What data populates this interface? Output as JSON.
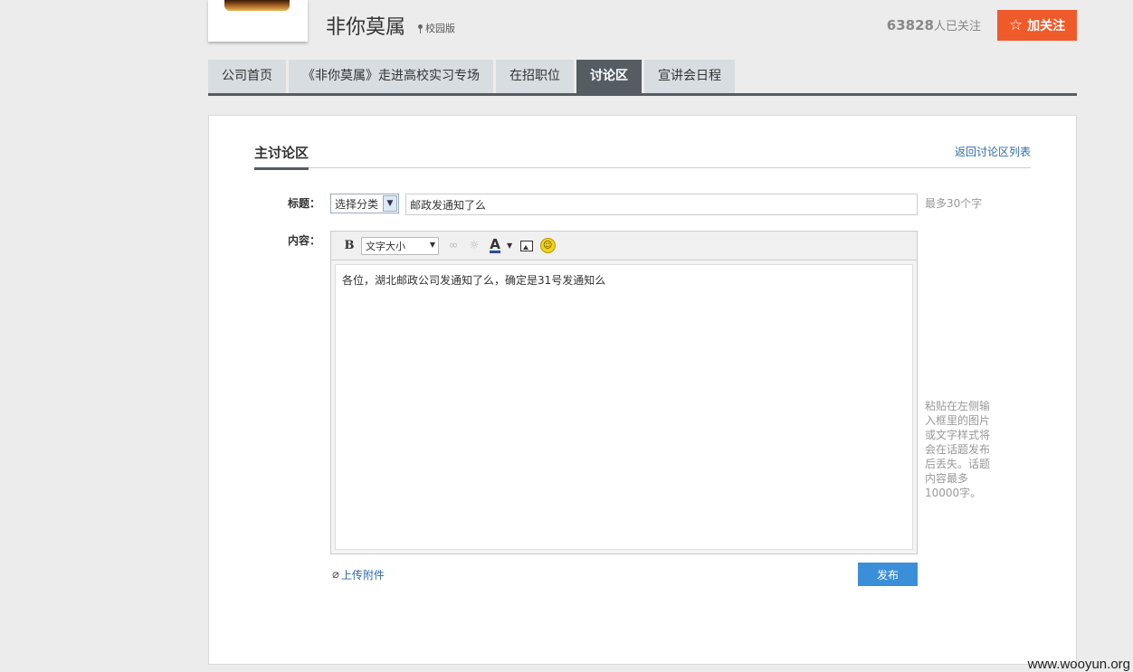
{
  "header": {
    "company_name": "非你莫属",
    "campus_tag": "校园版",
    "followers_count": "63828",
    "followers_suffix": "人已关注",
    "follow_button": "加关注"
  },
  "tabs": [
    {
      "label": "公司首页",
      "active": false
    },
    {
      "label": "《非你莫属》走进高校实习专场",
      "active": false
    },
    {
      "label": "在招职位",
      "active": false
    },
    {
      "label": "讨论区",
      "active": true
    },
    {
      "label": "宣讲会日程",
      "active": false
    }
  ],
  "main": {
    "section_title": "主讨论区",
    "back_link": "返回讨论区列表",
    "title_label": "标题：",
    "category_select": "选择分类",
    "title_value": "邮政发通知了么",
    "title_hint": "最多30个字",
    "content_label": "内容：",
    "toolbar": {
      "bold": "B",
      "font_size": "文字大小",
      "font_color": "A"
    },
    "content_value": "各位，湖北邮政公司发通知了么，确定是31号发通知么",
    "side_note": "粘贴在左侧输入框里的图片或文字样式将会在话题发布后丢失。话题内容最多10000字。",
    "attach_link": "上传附件",
    "publish_button": "发布"
  },
  "watermark": "www.wooyun.org",
  "icons": [
    "star-icon",
    "pin-icon",
    "chevron-down-icon",
    "link-icon",
    "unlink-icon",
    "image-icon",
    "smile-icon",
    "paperclip-icon"
  ],
  "colors": {
    "accent_orange": "#ef5a2a",
    "tab_active": "#555d63",
    "tab_inactive": "#d7dde1",
    "publish_blue": "#3a8fd8",
    "link_blue": "#2b6aa7"
  }
}
